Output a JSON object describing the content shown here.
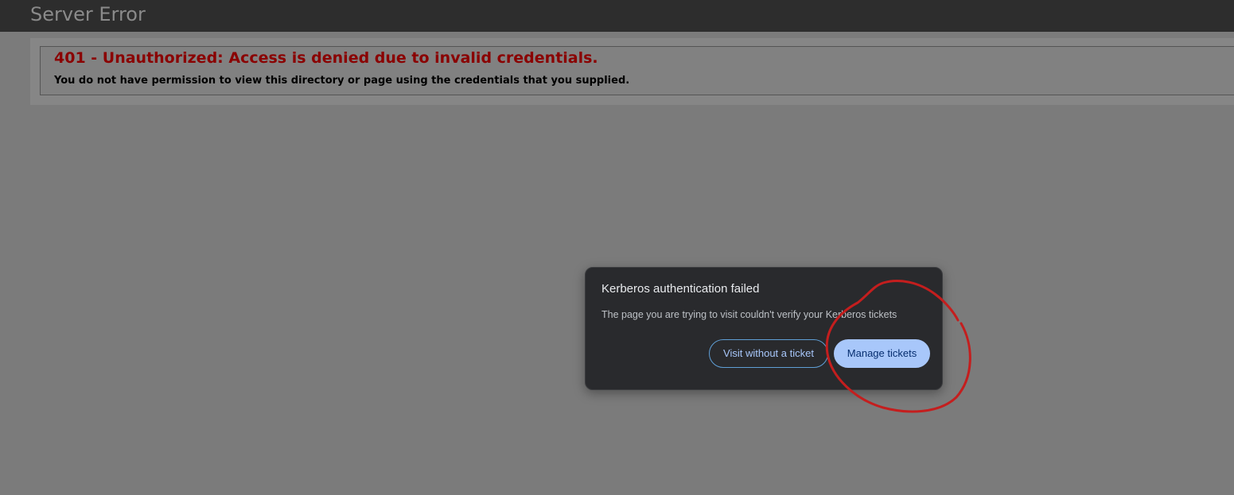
{
  "header": {
    "title": "Server Error"
  },
  "error": {
    "heading": "401 - Unauthorized: Access is denied due to invalid credentials.",
    "detail": "You do not have permission to view this directory or page using the credentials that you supplied."
  },
  "dialog": {
    "title": "Kerberos authentication failed",
    "message": "The page you are trying to visit couldn't verify your Kerberos tickets",
    "secondary_button_label": "Visit without a ticket",
    "primary_button_label": "Manage tickets"
  },
  "colors": {
    "error_red": "#8a0000",
    "dialog_background": "#292a2d",
    "primary_button": "#a8c7fa",
    "annotation_red": "#c41e1e"
  }
}
